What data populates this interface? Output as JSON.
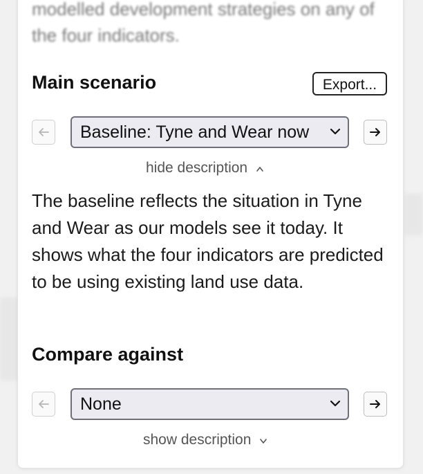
{
  "intro_blurred": "modelled development strategies on any of the four indicators.",
  "main": {
    "heading": "Main scenario",
    "export_label": "Export...",
    "selected": "Baseline: Tyne and Wear now",
    "toggle_label": "hide description",
    "toggle_glyph": "^",
    "description": "The baseline reflects the situation in Tyne and Wear as our models see it today. It shows what the four indicators are predicted to be using existing land use data."
  },
  "compare": {
    "heading": "Compare against",
    "selected": "None",
    "toggle_label": "show description",
    "toggle_glyph": "v"
  },
  "icons": {
    "prev": "left-arrow-icon",
    "next": "right-arrow-icon",
    "dropdown": "chevron-down-icon"
  }
}
